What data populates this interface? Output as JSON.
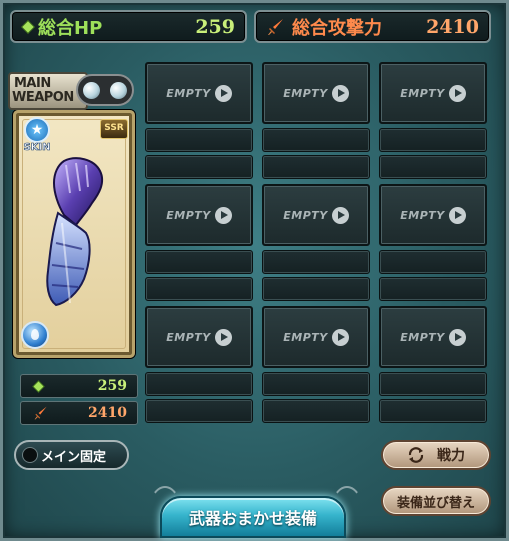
{
  "header": {
    "hp_label": "総合HP",
    "hp_value": "259",
    "atk_label": "総合攻撃力",
    "atk_value": "2410"
  },
  "main_weapon": {
    "badge_line1": "MAIN",
    "badge_line2": "WEAPON",
    "skin_label": "SKIN",
    "rarity": "SSR",
    "hp": "259",
    "atk": "2410"
  },
  "slots": {
    "empty_label": "EMPTY",
    "rows": 3,
    "cols": 3
  },
  "buttons": {
    "lock_main": "メイン固定",
    "power": "戦力",
    "sort": "装備並び替え",
    "auto_equip": "武器おまかせ装備"
  },
  "colors": {
    "hp": "#9ee05a",
    "atk": "#ff8a4c",
    "panel_bg": "#2a5c62"
  }
}
